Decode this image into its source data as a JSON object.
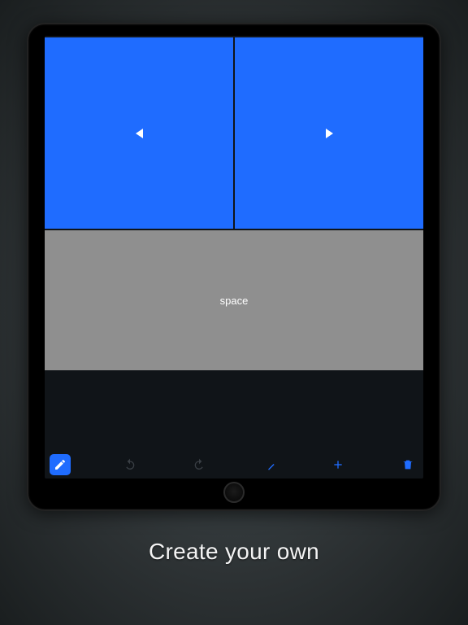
{
  "caption": "Create your own",
  "editor": {
    "keys": {
      "left_arrow": {
        "icon": "triangle-left"
      },
      "right_arrow": {
        "icon": "triangle-right"
      },
      "space_label": "space"
    }
  },
  "toolbar": {
    "edit_icon": "pencil",
    "undo_icon": "undo",
    "redo_icon": "redo",
    "divider_icon": "minus",
    "add_icon": "plus",
    "delete_icon": "trash"
  },
  "colors": {
    "accent": "#1f6cff",
    "key_gray": "#8f8f8f",
    "screen_bg": "#101418"
  }
}
